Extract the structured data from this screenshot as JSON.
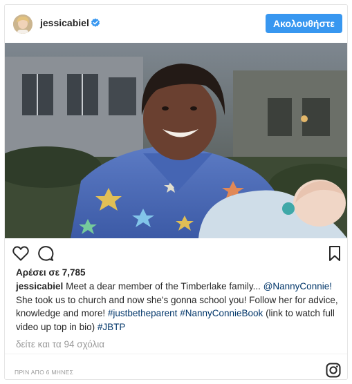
{
  "header": {
    "username": "jessicabiel",
    "follow_label": "Ακολουθήστε"
  },
  "post": {
    "likes_text": "Αρέσει σε 7,785",
    "caption": {
      "username": "jessicabiel",
      "text_1": "Meet a dear member of the Timberlake family...",
      "mention": "@NannyConnie!",
      "text_2": "She took us to church and now she's gonna school you! Follow her for advice, knowledge and more!",
      "hashtag_1": "#justbetheparent",
      "hashtag_2": "#NannyConnieBook",
      "text_3": "(link to watch full video up top in bio)",
      "hashtag_3": "#JBTP"
    },
    "comments_link": "δείτε και τα 94 σχόλια",
    "time_ago": "ΠΡΙΝ ΑΠΟ 6 ΜΗΝΕΣ"
  },
  "icons": {
    "like": "heart-icon",
    "comment": "comment-icon",
    "save": "bookmark-icon",
    "verified": "verified-badge-icon",
    "brand": "instagram-icon"
  },
  "colors": {
    "accent": "#3897f0",
    "hashtag": "#003569",
    "muted": "#999999"
  }
}
